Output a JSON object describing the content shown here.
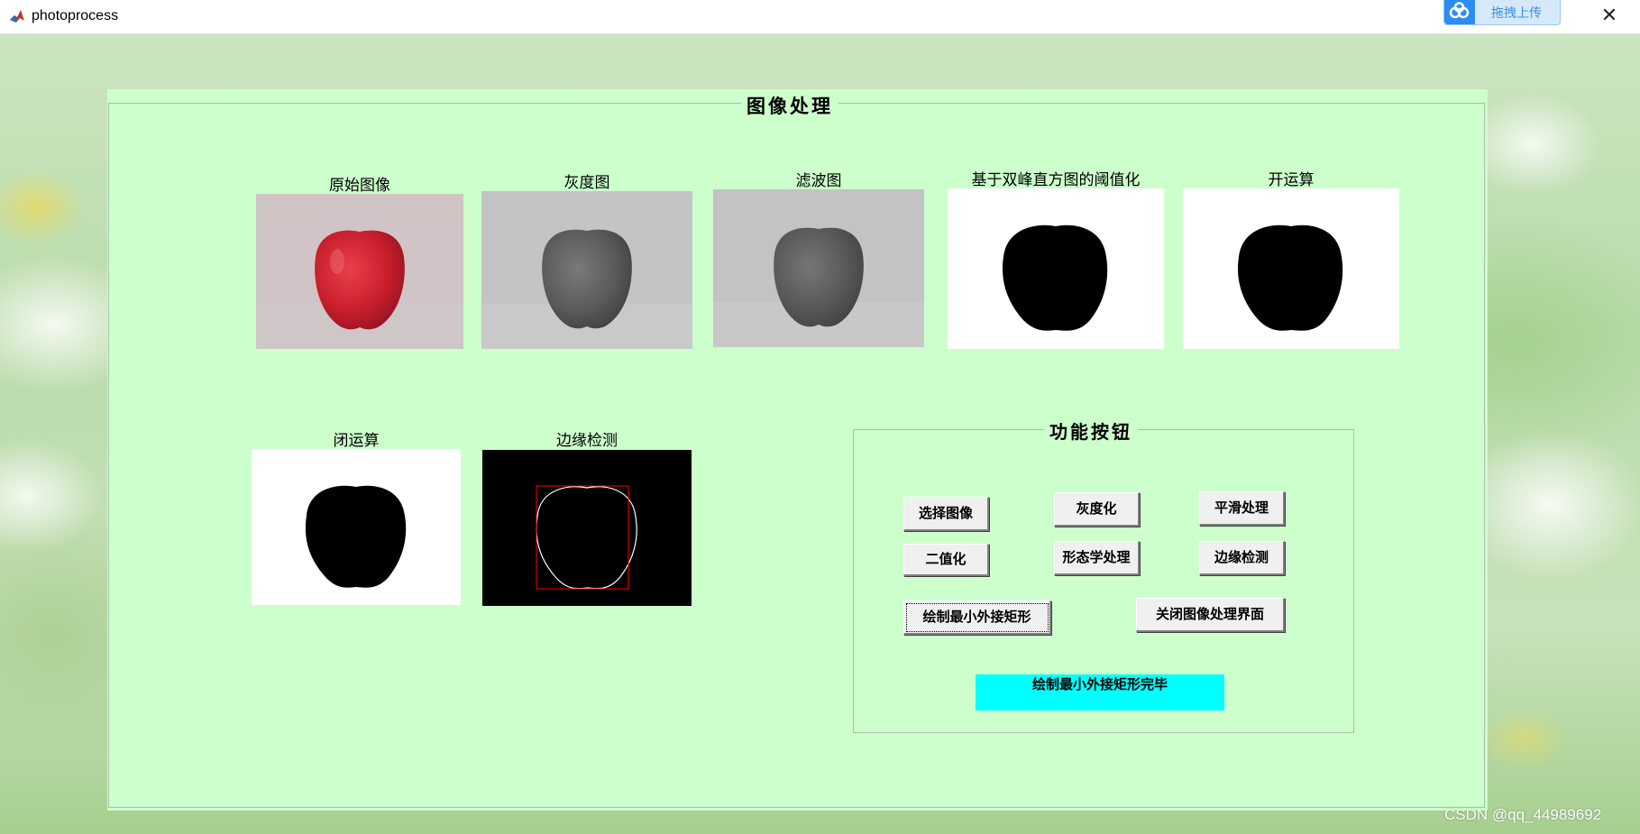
{
  "window": {
    "title": "photoprocess",
    "upload_label": "拖拽上传"
  },
  "main": {
    "title": "图像处理",
    "images": [
      {
        "label": "原始图像"
      },
      {
        "label": "灰度图"
      },
      {
        "label": "滤波图"
      },
      {
        "label": "基于双峰直方图的阈值化"
      },
      {
        "label": "开运算"
      },
      {
        "label": "闭运算"
      },
      {
        "label": "边缘检测"
      }
    ]
  },
  "functions": {
    "title": "功能按钮",
    "buttons": {
      "select_image": "选择图像",
      "grayscale": "灰度化",
      "smooth": "平滑处理",
      "binarize": "二值化",
      "morphology": "形态学处理",
      "edge_detect": "边缘检测",
      "draw_rect": "绘制最小外接矩形",
      "close": "关闭图像处理界面"
    },
    "status": "绘制最小外接矩形完毕"
  },
  "watermark": "CSDN @qq_44989692",
  "colors": {
    "panel_bg": "#ccffcc",
    "status_bg": "#00ffff",
    "bounding_rect": "#ff0000"
  }
}
